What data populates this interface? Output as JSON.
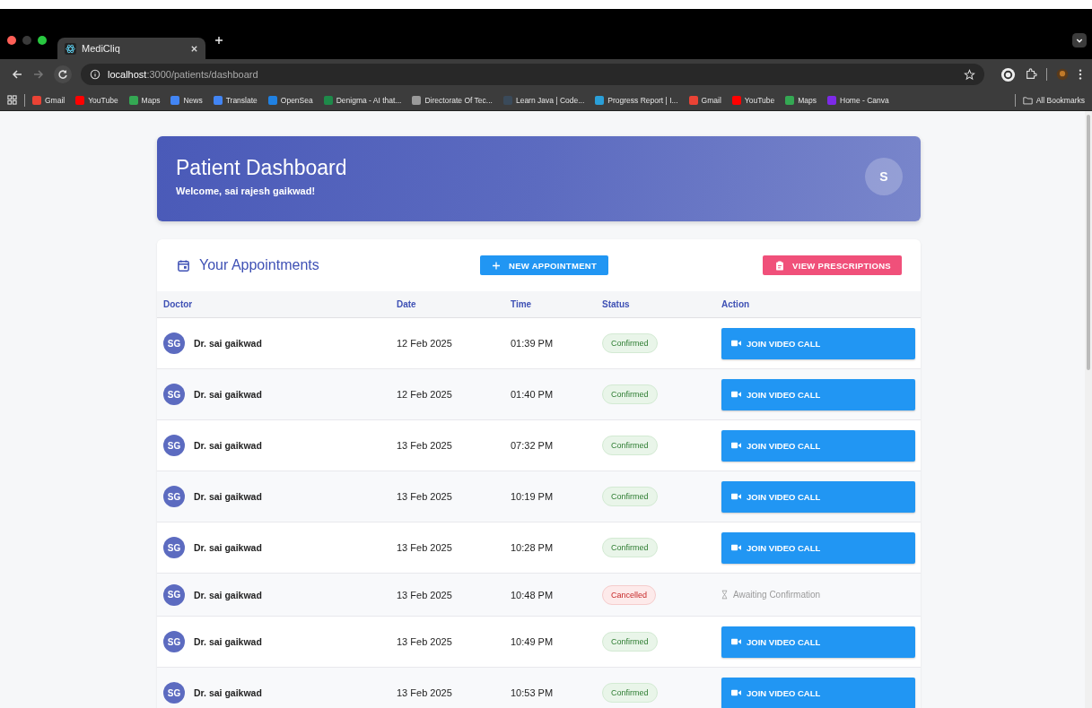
{
  "browser": {
    "tab_title": "MediCliq",
    "url_host": "localhost",
    "url_path": ":3000/patients/dashboard",
    "bookmarks": [
      {
        "label": "Gmail",
        "color": "#ea4335"
      },
      {
        "label": "YouTube",
        "color": "#ff0000"
      },
      {
        "label": "Maps",
        "color": "#34a853"
      },
      {
        "label": "News",
        "color": "#4285f4"
      },
      {
        "label": "Translate",
        "color": "#4285f4"
      },
      {
        "label": "OpenSea",
        "color": "#2081e2"
      },
      {
        "label": "Denigma - AI that...",
        "color": "#1e8a4a"
      },
      {
        "label": "Directorate Of Tec...",
        "color": "#9a9a9a"
      },
      {
        "label": "Learn Java | Code...",
        "color": "#3a4a5a"
      },
      {
        "label": "Progress Report | I...",
        "color": "#2a9fd8"
      },
      {
        "label": "Gmail",
        "color": "#ea4335"
      },
      {
        "label": "YouTube",
        "color": "#ff0000"
      },
      {
        "label": "Maps",
        "color": "#34a853"
      },
      {
        "label": "Home - Canva",
        "color": "#7d2ae8"
      }
    ],
    "all_bookmarks": "All Bookmarks"
  },
  "header": {
    "title": "Patient Dashboard",
    "welcome": "Welcome, sai rajesh gaikwad!",
    "avatar": "S"
  },
  "appointments": {
    "title": "Your Appointments",
    "new_button": "NEW APPOINTMENT",
    "prescriptions_button": "VIEW PRESCRIPTIONS",
    "columns": [
      "Doctor",
      "Date",
      "Time",
      "Status",
      "Action"
    ],
    "rows": [
      {
        "initials": "SG",
        "doctor": "Dr. sai gaikwad",
        "date": "12 Feb 2025",
        "time": "01:39 PM",
        "status": {
          "label": "Confirmed",
          "kind": "confirmed"
        },
        "action": {
          "label": "JOIN VIDEO CALL",
          "kind": "video"
        }
      },
      {
        "initials": "SG",
        "doctor": "Dr. sai gaikwad",
        "date": "12 Feb 2025",
        "time": "01:40 PM",
        "status": {
          "label": "Confirmed",
          "kind": "confirmed"
        },
        "action": {
          "label": "JOIN VIDEO CALL",
          "kind": "video"
        }
      },
      {
        "initials": "SG",
        "doctor": "Dr. sai gaikwad",
        "date": "13 Feb 2025",
        "time": "07:32 PM",
        "status": {
          "label": "Confirmed",
          "kind": "confirmed"
        },
        "action": {
          "label": "JOIN VIDEO CALL",
          "kind": "video"
        }
      },
      {
        "initials": "SG",
        "doctor": "Dr. sai gaikwad",
        "date": "13 Feb 2025",
        "time": "10:19 PM",
        "status": {
          "label": "Confirmed",
          "kind": "confirmed"
        },
        "action": {
          "label": "JOIN VIDEO CALL",
          "kind": "video"
        }
      },
      {
        "initials": "SG",
        "doctor": "Dr. sai gaikwad",
        "date": "13 Feb 2025",
        "time": "10:28 PM",
        "status": {
          "label": "Confirmed",
          "kind": "confirmed"
        },
        "action": {
          "label": "JOIN VIDEO CALL",
          "kind": "video"
        }
      },
      {
        "initials": "SG",
        "doctor": "Dr. sai gaikwad",
        "date": "13 Feb 2025",
        "time": "10:48 PM",
        "status": {
          "label": "Cancelled",
          "kind": "cancelled"
        },
        "action": {
          "label": "Awaiting Confirmation",
          "kind": "awaiting"
        }
      },
      {
        "initials": "SG",
        "doctor": "Dr. sai gaikwad",
        "date": "13 Feb 2025",
        "time": "10:49 PM",
        "status": {
          "label": "Confirmed",
          "kind": "confirmed"
        },
        "action": {
          "label": "JOIN VIDEO CALL",
          "kind": "video"
        }
      },
      {
        "initials": "SG",
        "doctor": "Dr. sai gaikwad",
        "date": "13 Feb 2025",
        "time": "10:53 PM",
        "status": {
          "label": "Confirmed",
          "kind": "confirmed"
        },
        "action": {
          "label": "JOIN VIDEO CALL",
          "kind": "video"
        }
      }
    ]
  }
}
